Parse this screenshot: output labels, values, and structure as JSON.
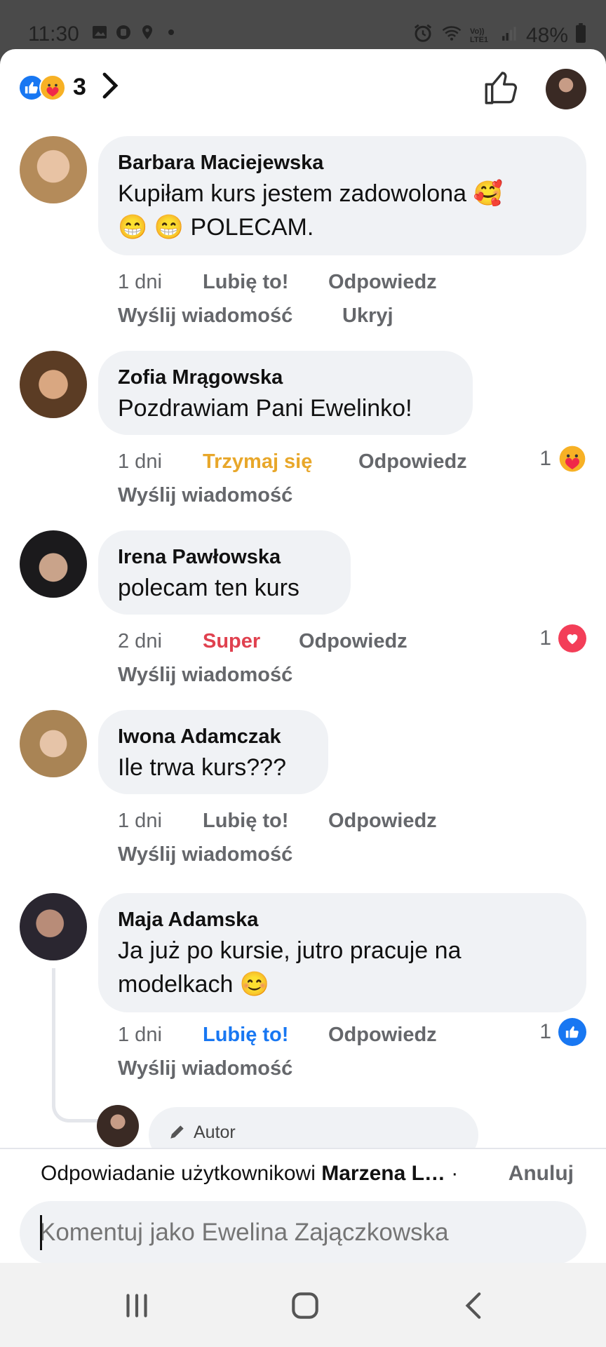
{
  "status_bar": {
    "time": "11:30",
    "network": "Vo)) LTE1",
    "battery": "48%"
  },
  "top_bar": {
    "reaction_count": "3",
    "reaction_types": [
      "like",
      "care"
    ]
  },
  "comments": [
    {
      "author": "Barbara Maciejewska",
      "text_lines": [
        "Kupiłam kurs jestem zadowolona 🥰",
        "😁 😁 POLECAM."
      ],
      "time": "1 dni",
      "reaction_action": "Lubię to!",
      "reply": "Odpowiedz",
      "send_message": "Wyślij wiadomość",
      "hide": "Ukryj"
    },
    {
      "author": "Zofia Mrągowska",
      "text_lines": [
        "Pozdrawiam Pani Ewelinko!"
      ],
      "time": "1 dni",
      "reaction_action": "Trzymaj się",
      "reply": "Odpowiedz",
      "send_message": "Wyślij wiadomość",
      "reaction_count": "1"
    },
    {
      "author": "Irena Pawłowska",
      "text_lines": [
        "polecam ten kurs"
      ],
      "time": "2 dni",
      "reaction_action": "Super",
      "reply": "Odpowiedz",
      "send_message": "Wyślij wiadomość",
      "reaction_count": "1"
    },
    {
      "author": "Iwona Adamczak",
      "text_lines": [
        "Ile trwa kurs???"
      ],
      "time": "1 dni",
      "reaction_action": "Lubię to!",
      "reply": "Odpowiedz",
      "send_message": "Wyślij wiadomość"
    },
    {
      "author": "Maja Adamska",
      "text_lines": [
        "Ja już po kursie, jutro pracuje na",
        "modelkach 😊"
      ],
      "time": "1 dni",
      "reaction_action": "Lubię to!",
      "reply": "Odpowiedz",
      "send_message": "Wyślij wiadomość",
      "reaction_count": "1"
    }
  ],
  "reply_preview": {
    "badge": "Autor"
  },
  "reply_bar": {
    "replying_prefix": "Odpowiadanie użytkownikowi ",
    "replying_name": "Marzena L…",
    "separator": " · ",
    "cancel": "Anuluj",
    "input_placeholder": "Komentuj jako Ewelina Zajączkowska"
  },
  "colors": {
    "like_blue": "#1877f2",
    "care_yellow": "#e8a72a",
    "love_red": "#e0414f",
    "bubble_bg": "#f0f2f5",
    "meta_gray": "#65676b"
  }
}
